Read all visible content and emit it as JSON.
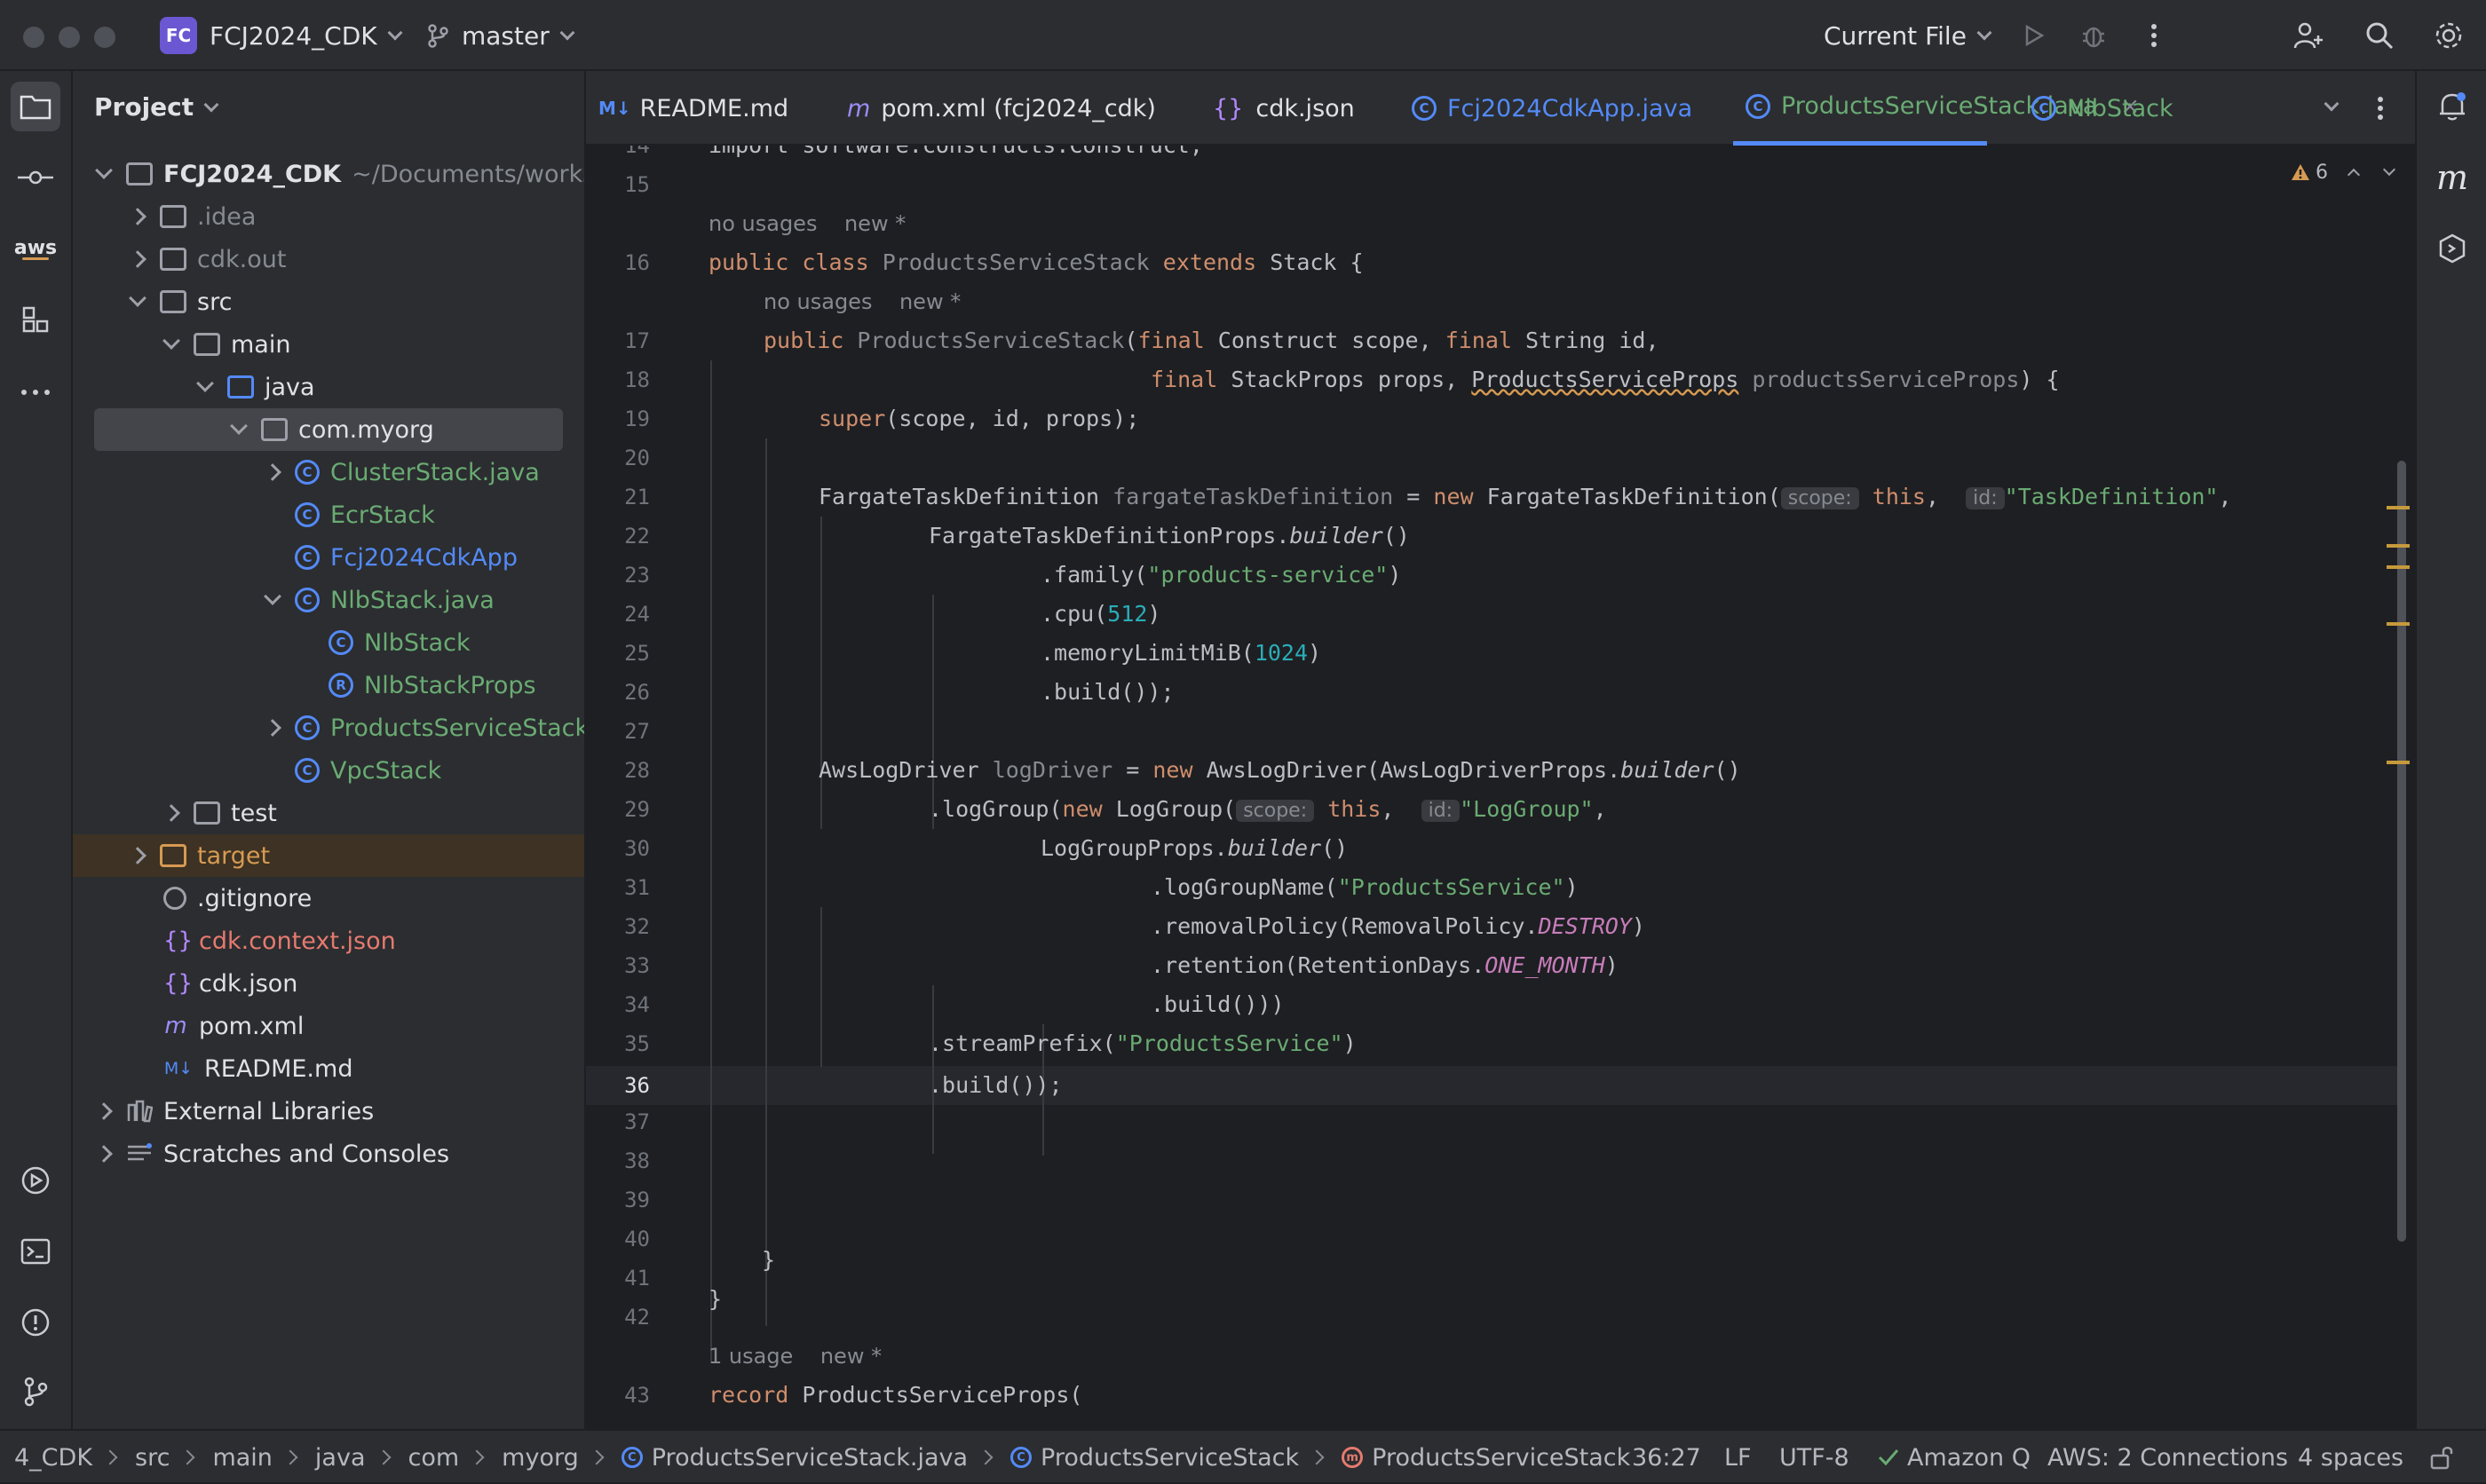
{
  "titlebar": {
    "project_badge": "FC",
    "project_name": "FCJ2024_CDK",
    "branch": "master",
    "run_config": "Current File"
  },
  "left_strip": {
    "aws_label": "aws"
  },
  "project_panel": {
    "title": "Project",
    "root_name": "FCJ2024_CDK",
    "root_path": "~/Documents/workshop",
    "items": [
      {
        "label": "FCJ2024_CDK"
      },
      {
        "label": ".idea"
      },
      {
        "label": "cdk.out"
      },
      {
        "label": "src"
      },
      {
        "label": "main"
      },
      {
        "label": "java"
      },
      {
        "label": "com.myorg"
      },
      {
        "label": "ClusterStack.java"
      },
      {
        "label": "EcrStack"
      },
      {
        "label": "Fcj2024CdkApp"
      },
      {
        "label": "NlbStack.java"
      },
      {
        "label": "NlbStack"
      },
      {
        "label": "NlbStackProps"
      },
      {
        "label": "ProductsServiceStack.java"
      },
      {
        "label": "VpcStack"
      },
      {
        "label": "test"
      },
      {
        "label": "target"
      },
      {
        "label": ".gitignore"
      },
      {
        "label": "cdk.context.json"
      },
      {
        "label": "cdk.json"
      },
      {
        "label": "pom.xml"
      },
      {
        "label": "README.md"
      },
      {
        "label": "External Libraries"
      },
      {
        "label": "Scratches and Consoles"
      }
    ]
  },
  "tabs": [
    {
      "icon": "M↓",
      "label": "README.md"
    },
    {
      "icon": "m",
      "label": "pom.xml (fcj2024_cdk)"
    },
    {
      "icon": "{}",
      "label": "cdk.json"
    },
    {
      "icon": "C",
      "label": "Fcj2024CdkApp.java"
    },
    {
      "icon": "C",
      "label": "ProductsServiceStack.java"
    },
    {
      "icon": "C",
      "label": "NlbStack"
    }
  ],
  "editor": {
    "warning_count": "6",
    "line_numbers": [
      "14",
      "15",
      "16",
      "17",
      "18",
      "19",
      "20",
      "21",
      "22",
      "23",
      "24",
      "25",
      "26",
      "27",
      "28",
      "29",
      "30",
      "31",
      "32",
      "33",
      "34",
      "35",
      "36",
      "37",
      "38",
      "39",
      "40",
      "41",
      "42",
      "43"
    ],
    "current_line": "36",
    "hints": {
      "h1a": "no usages",
      "h1b": "new *",
      "h2a": "no usages",
      "h2b": "new *",
      "h3a": "1 usage",
      "h3b": "new *"
    },
    "inlays": {
      "scope": "scope:",
      "id": "id:"
    },
    "tokens": {
      "l14": "import software.constructs.Construct;",
      "l16_public": "public",
      "l16_class": "class",
      "l16_name": "ProductsServiceStack",
      "l16_extends": "extends",
      "l16_rest": "Stack {",
      "l17_public": "public",
      "l17_name": "ProductsServiceStack",
      "l17_paren": "(",
      "l17_final1": "final",
      "l17_mid": "Construct scope,",
      "l17_final2": "final",
      "l17_end": "String id,",
      "l18_final": "final",
      "l18_mid": "StackProps props,",
      "l18_type": "ProductsServiceProps",
      "l18_param": "productsServiceProps",
      "l18_end": ") {",
      "l19_super": "super",
      "l19_rest": "(scope, id, props);",
      "l21_type": "FargateTaskDefinition",
      "l21_var": "fargateTaskDefinition",
      "l21_eq": "=",
      "l21_new": "new",
      "l21_ctor": "FargateTaskDefinition(",
      "l21_this": "this",
      "l21_comma": ",",
      "l21_str": "\"TaskDefinition\"",
      "l21_end": ",",
      "l22": "FargateTaskDefinitionProps.",
      "l22_builder": "builder",
      "l22_end": "()",
      "l23_a": ".family(",
      "l23_str": "\"products-service\"",
      "l23_b": ")",
      "l24_a": ".cpu(",
      "l24_num": "512",
      "l24_b": ")",
      "l25_a": ".memoryLimitMiB(",
      "l25_num": "1024",
      "l25_b": ")",
      "l26": ".build());",
      "l28_type": "AwsLogDriver",
      "l28_var": "logDriver",
      "l28_eq": "=",
      "l28_new": "new",
      "l28_rest": "AwsLogDriver(AwsLogDriverProps.",
      "l28_builder": "builder",
      "l28_end": "()",
      "l29_a": ".logGroup(",
      "l29_new": "new",
      "l29_b": "LogGroup(",
      "l29_this": "this",
      "l29_comma": ",",
      "l29_str": "\"LogGroup\"",
      "l29_end": ",",
      "l30": "LogGroupProps.",
      "l30_builder": "builder",
      "l30_end": "()",
      "l31_a": ".logGroupName(",
      "l31_str": "\"ProductsService\"",
      "l31_b": ")",
      "l32_a": ".removalPolicy(RemovalPolicy.",
      "l32_fld": "DESTROY",
      "l32_b": ")",
      "l33_a": ".retention(RetentionDays.",
      "l33_fld": "ONE_MONTH",
      "l33_b": ")",
      "l34": ".build()))",
      "l35_a": ".streamPrefix(",
      "l35_str": "\"ProductsService\"",
      "l35_b": ")",
      "l36": ".build());",
      "l40": "}",
      "l41": "}",
      "l43_kw": "record",
      "l43_rest": "ProductsServiceProps("
    }
  },
  "statusbar": {
    "breadcrumbs": [
      "4_CDK",
      "src",
      "main",
      "java",
      "com",
      "myorg",
      "ProductsServiceStack.java",
      "ProductsServiceStack",
      "ProductsServiceStack"
    ],
    "position": "36:27",
    "line_sep": "LF",
    "encoding": "UTF-8",
    "amazon_q": "Amazon Q",
    "aws": "AWS: 2 Connections",
    "indent": "4 spaces"
  },
  "colors": {
    "accent": "#548af7",
    "keyword": "#cf8e6d",
    "string": "#6aab73",
    "number": "#2aacb8",
    "warning": "#d69a52"
  }
}
